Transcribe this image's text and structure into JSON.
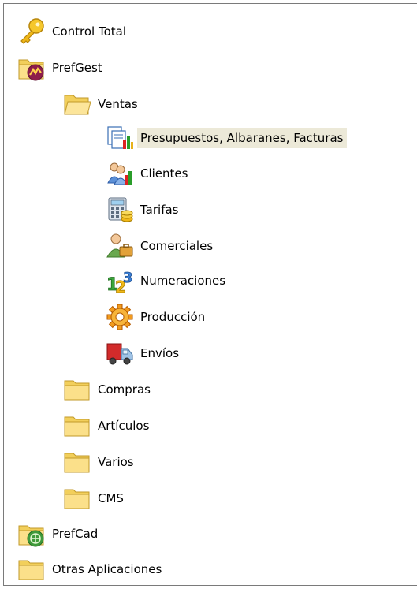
{
  "tree": {
    "control_total": {
      "label": "Control Total",
      "icon": "key-icon"
    },
    "prefgest": {
      "label": "PrefGest",
      "icon": "prefgest-folder-icon",
      "ventas": {
        "label": "Ventas",
        "icon": "open-folder-icon",
        "items": [
          {
            "label": "Presupuestos, Albaranes, Facturas",
            "icon": "documents-chart-icon",
            "selected": true
          },
          {
            "label": "Clientes",
            "icon": "users-chart-icon"
          },
          {
            "label": "Tarifas",
            "icon": "calculator-coins-icon"
          },
          {
            "label": "Comerciales",
            "icon": "salesman-briefcase-icon"
          },
          {
            "label": "Numeraciones",
            "icon": "numbers-123-icon"
          },
          {
            "label": "Producción",
            "icon": "gear-icon"
          },
          {
            "label": "Envíos",
            "icon": "delivery-truck-icon"
          }
        ]
      },
      "compras": {
        "label": "Compras",
        "icon": "folder-icon"
      },
      "articulos": {
        "label": "Artículos",
        "icon": "folder-icon"
      },
      "varios": {
        "label": "Varios",
        "icon": "folder-icon"
      },
      "cms": {
        "label": "CMS",
        "icon": "folder-icon"
      }
    },
    "prefcad": {
      "label": "PrefCad",
      "icon": "prefcad-folder-icon"
    },
    "otras": {
      "label": "Otras Aplicaciones",
      "icon": "folder-icon"
    }
  },
  "colors": {
    "selection_bg": "#ece9d8",
    "border": "#7a7a7a",
    "folder_yellow": "#f7d768"
  }
}
